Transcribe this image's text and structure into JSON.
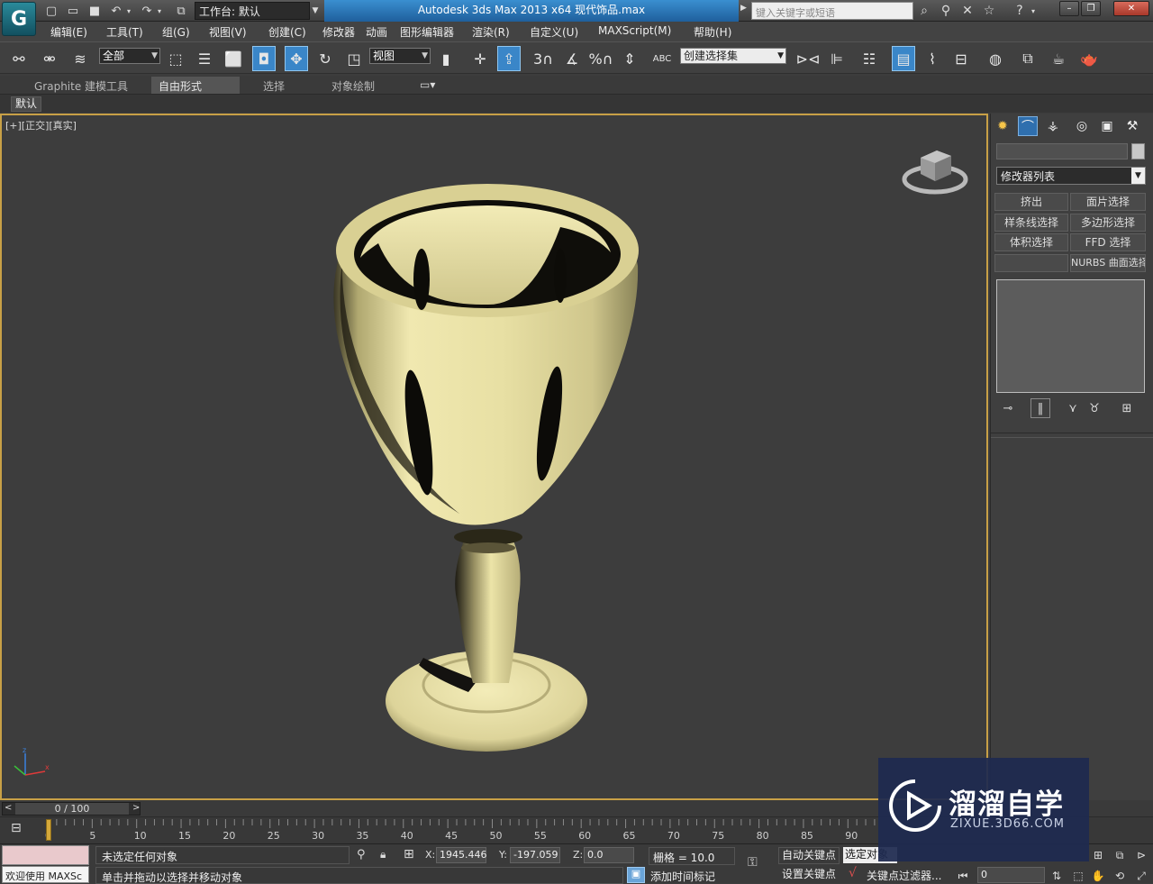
{
  "titlebar": {
    "workspace_label": "工作台: 默认",
    "title": "Autodesk 3ds Max  2013 x64      现代饰品.max",
    "search_placeholder": "键入关键字或短语"
  },
  "menu": [
    "编辑(E)",
    "工具(T)",
    "组(G)",
    "视图(V)",
    "创建(C)",
    "修改器",
    "动画",
    "图形编辑器",
    "渲染(R)",
    "自定义(U)",
    "MAXScript(M)",
    "帮助(H)"
  ],
  "toolbar": {
    "selection_filter": "全部",
    "ref_coord": "视图",
    "named_selection": "创建选择集",
    "snap_num": "3",
    "angle_label": "%",
    "abc_label": "ABC"
  },
  "ribbon": {
    "tabs": [
      "Graphite 建模工具",
      "自由形式",
      "选择",
      "对象绘制"
    ],
    "active_tab": "自由形式",
    "sub_label": "默认"
  },
  "viewport": {
    "label": "[+][正交][真实]",
    "axis_z": "z",
    "axis_x": "x"
  },
  "command_panel": {
    "modifier_list": "修改器列表",
    "buttons": [
      "挤出",
      "面片选择",
      "样条线选择",
      "多边形选择",
      "体积选择",
      "FFD 选择",
      "",
      "NURBS 曲面选择"
    ]
  },
  "timeslider": {
    "frame_text": "0 / 100",
    "ticks": [
      "0",
      "5",
      "10",
      "15",
      "20",
      "25",
      "30",
      "35",
      "40",
      "45",
      "50",
      "55",
      "60",
      "65",
      "70",
      "75",
      "80",
      "85",
      "90"
    ]
  },
  "status": {
    "welcome": "欢迎使用 MAXSc",
    "selection": "未选定任何对象",
    "prompt": "单击并拖动以选择并移动对象",
    "x_label": "X:",
    "x": "1945.446",
    "y_label": "Y:",
    "y": "-197.059",
    "z_label": "Z:",
    "z": "0.0",
    "grid": "栅格 = 10.0",
    "add_marker": "添加时间标记",
    "auto_key": "自动关键点",
    "set_key": "设置关键点",
    "key_select": "选定对象",
    "key_filter": "关键点过滤器...",
    "frame": "0"
  },
  "watermark": {
    "title": "溜溜自学",
    "url": "ZIXUE.3D66.COM"
  },
  "colors": {
    "accent": "#3a86c8",
    "viewport_border": "#c8a046",
    "goblet": "#e8e0a4"
  }
}
